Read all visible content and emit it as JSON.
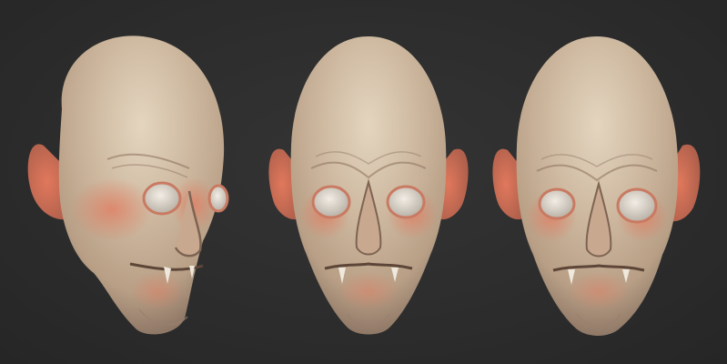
{
  "scene": {
    "subject": "sculpted-vampire-head",
    "background_color": "#2c2c2c",
    "skin_base_color": "#c9b49a",
    "skin_highlight_color": "#e0d0b8",
    "skin_flush_color": "#d9735a",
    "eye_color": "#d8d2c8"
  },
  "views": [
    {
      "name": "three-quarter-view"
    },
    {
      "name": "front-view"
    },
    {
      "name": "front-view-alt"
    }
  ]
}
